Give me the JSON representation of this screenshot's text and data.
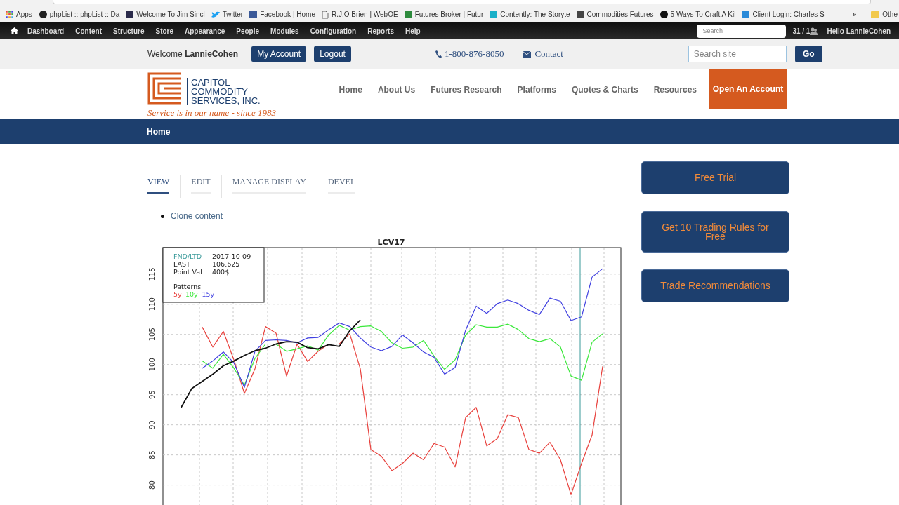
{
  "bookmarks_bar": {
    "items": [
      {
        "label": "Apps"
      },
      {
        "label": "phpList :: phpList :: Da"
      },
      {
        "label": "Welcome To Jim Sincl"
      },
      {
        "label": "Twitter"
      },
      {
        "label": "Facebook | Home"
      },
      {
        "label": "R.J.O Brien | WebOE"
      },
      {
        "label": "Futures Broker | Futur"
      },
      {
        "label": "Contently: The Storyte"
      },
      {
        "label": "Commodities Futures"
      },
      {
        "label": "5 Ways To Craft A Kil"
      },
      {
        "label": "Client Login: Charles S"
      }
    ],
    "overflow": "»",
    "other": "Othe"
  },
  "admin_bar": {
    "items": [
      "Dashboard",
      "Content",
      "Structure",
      "Store",
      "Appearance",
      "People",
      "Modules",
      "Configuration",
      "Reports",
      "Help"
    ],
    "search": {
      "placeholder": "Search"
    },
    "count": "31 / 1",
    "greeting": "Hello",
    "user": "LannieCohen"
  },
  "top_bar": {
    "welcome": "Welcome",
    "user": "LannieCohen",
    "buttons": [
      "My Account",
      "Logout"
    ],
    "phone": "1-800-876-8050",
    "contact": "Contact",
    "search": {
      "placeholder": "Search site"
    },
    "go": "Go"
  },
  "header": {
    "logo_lines": [
      "CAPITOL",
      "COMMODITY",
      "SERVICES, INC."
    ],
    "tagline": "Service is in our name - since 1983",
    "nav": [
      "Home",
      "About Us",
      "Futures Research",
      "Platforms",
      "Quotes & Charts",
      "Resources"
    ],
    "cta": "Open An Account"
  },
  "breadcrumb": "Home",
  "tabs": [
    {
      "label": "VIEW",
      "selected": true
    },
    {
      "label": "EDIT",
      "selected": false
    },
    {
      "label": "MANAGE DISPLAY",
      "selected": false
    },
    {
      "label": "DEVEL",
      "selected": false
    }
  ],
  "links": [
    "Clone content"
  ],
  "chart": {
    "legend": [
      {
        "label": "FND/LTD",
        "value": "2017-10-09"
      },
      {
        "label": "LAST",
        "value": "106.625"
      },
      {
        "label": "Point Val.",
        "value": "400$"
      }
    ],
    "patterns_title": "Patterns",
    "chart_data": {
      "type": "line",
      "title": "LCV17",
      "grid": true,
      "ylim": [
        76.0,
        119.4
      ],
      "yticks": [
        115,
        110,
        105,
        100,
        95,
        90,
        85,
        80
      ],
      "series": [
        {
          "name": "5y",
          "color": "#e8403c",
          "values": [
            null,
            null,
            106.2,
            102.9,
            105.5,
            100.8,
            95.2,
            99.3,
            106.3,
            105.2,
            98.1,
            103.4,
            100.5,
            102.2,
            103.4,
            103.4,
            105.1,
            99.3,
            85.9,
            84.8,
            82.4,
            83.6,
            85.3,
            84.2,
            86.9,
            86.3,
            83.0,
            91.2,
            92.9,
            86.5,
            87.7,
            91.7,
            91.2,
            85.9,
            85.3,
            87.1,
            84.2,
            78.4,
            83.6,
            88.3,
            99.7
          ]
        },
        {
          "name": "10y",
          "color": "#3ce83c",
          "values": [
            null,
            null,
            100.6,
            99.4,
            101.7,
            99.4,
            96.6,
            101.0,
            103.4,
            103.4,
            102.2,
            102.6,
            103.1,
            102.4,
            104.9,
            106.5,
            105.7,
            106.3,
            106.4,
            105.5,
            103.6,
            102.7,
            102.9,
            104.0,
            101.4,
            99.2,
            100.8,
            104.9,
            106.6,
            106.2,
            106.2,
            106.7,
            105.8,
            104.3,
            103.8,
            104.3,
            102.9,
            98.1,
            97.4,
            103.7,
            105.1
          ]
        },
        {
          "name": "15y",
          "color": "#4040e0",
          "values": [
            null,
            null,
            99.4,
            100.6,
            102.1,
            100.3,
            96.2,
            102.2,
            104.0,
            104.1,
            104.0,
            103.6,
            104.4,
            104.5,
            105.8,
            106.9,
            106.3,
            104.4,
            102.9,
            102.3,
            103.0,
            104.9,
            103.6,
            102.1,
            101.2,
            98.4,
            99.5,
            105.7,
            109.7,
            108.5,
            110.1,
            110.7,
            110.1,
            109.0,
            108.3,
            111.0,
            110.5,
            107.3,
            107.9,
            114.5,
            115.9
          ]
        },
        {
          "color": "#111111",
          "values": [
            92.9,
            96.0,
            97.2,
            98.4,
            99.8,
            100.6,
            101.5,
            102.3,
            102.7,
            103.4,
            103.8,
            103.7,
            102.8,
            102.6,
            103.3,
            103.0,
            105.6,
            107.4,
            null,
            null,
            null,
            null,
            null,
            null,
            null,
            null,
            null,
            null,
            null,
            null,
            null,
            null,
            null,
            null,
            null,
            null,
            null,
            null,
            null,
            null,
            null
          ]
        }
      ]
    }
  },
  "sidebar_buttons": [
    "Free Trial",
    "Get 10 Trading Rules for Free",
    "Trade Recommendations"
  ]
}
